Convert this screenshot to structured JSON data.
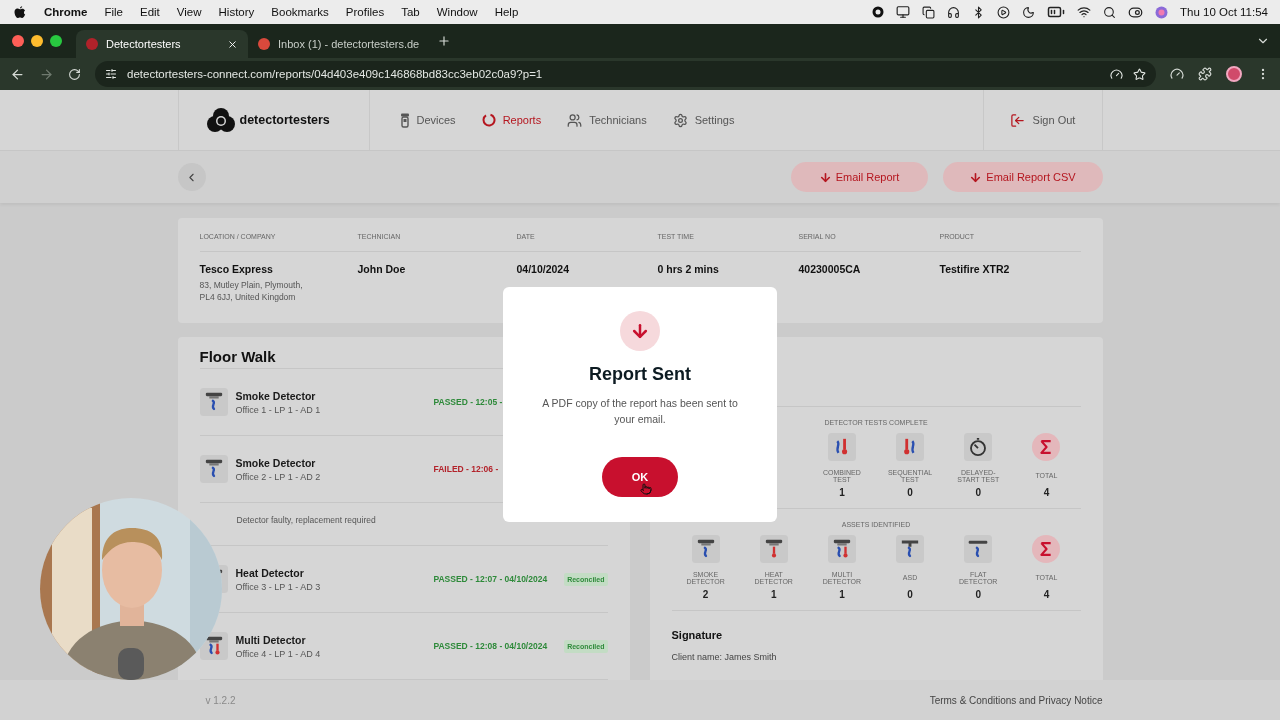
{
  "menu_bar": {
    "app": "Chrome",
    "menus": [
      "File",
      "Edit",
      "View",
      "History",
      "Bookmarks",
      "Profiles",
      "Tab",
      "Window",
      "Help"
    ],
    "clock": "Thu 10 Oct  11:54"
  },
  "browser": {
    "tabs": [
      {
        "title": "Detectortesters",
        "selected": true
      },
      {
        "title": "Inbox (1) - detectortesters.de",
        "selected": false
      }
    ],
    "url": "detectortesters-connect.com/reports/04d403e409c146868bd83cc3eb02c0a9?p=1"
  },
  "header": {
    "logo": "detectortesters",
    "nav": [
      {
        "label": "Devices",
        "kind": "devices",
        "selected": false
      },
      {
        "label": "Reports",
        "kind": "reports",
        "selected": true
      },
      {
        "label": "Technicians",
        "kind": "technicians",
        "selected": false
      },
      {
        "label": "Settings",
        "kind": "settings",
        "selected": false
      }
    ],
    "sign_out": "Sign Out"
  },
  "actions": [
    "Email Report",
    "Email Report CSV"
  ],
  "info": [
    {
      "label": "LOCATION / COMPANY",
      "value": "Tesco Express",
      "detail": [
        "83, Mutley Plain, Plymouth,",
        "PL4 6JJ, United Kingdom"
      ]
    },
    {
      "label": "TECHNICIAN",
      "value": "John Doe"
    },
    {
      "label": "DATE",
      "value": "04/10/2024"
    },
    {
      "label": "TEST TIME",
      "value": "0 hrs 2 mins"
    },
    {
      "label": "SERIAL NO",
      "value": "40230005CA"
    },
    {
      "label": "PRODUCT",
      "value": "Testifire XTR2"
    }
  ],
  "floor_walk": {
    "title": "Floor Walk",
    "rows": [
      {
        "kind": "smoke",
        "name": "Smoke Detector",
        "location": "Office 1 - LP 1 - AD 1",
        "result": "PASSED - 12:05 -",
        "passed": true
      },
      {
        "kind": "smoke",
        "name": "Smoke Detector",
        "location": "Office 2 - LP 1 - AD 2",
        "result": "FAILED - 12:06 -",
        "passed": false,
        "note": "Detector faulty, replacement required"
      },
      {
        "kind": "heat",
        "name": "Heat Detector",
        "location": "Office 3 - LP 1 - AD 3",
        "result": "PASSED - 12:07 - 04/10/2024",
        "passed": true,
        "badge": "Reconciled"
      },
      {
        "kind": "multi",
        "name": "Multi Detector",
        "location": "Office 4 - LP 1 - AD 4",
        "result": "PASSED - 12:08 - 04/10/2024",
        "passed": true,
        "badge": "Reconciled"
      }
    ]
  },
  "summary": {
    "tests": {
      "title": "DETECTOR TESTS COMPLETE",
      "items": [
        {
          "kind": "combined",
          "label": "COMBINED TEST",
          "count": "1"
        },
        {
          "kind": "sequential",
          "label": "SEQUENTIAL TEST",
          "count": "0"
        },
        {
          "kind": "delayed",
          "label": "DELAYED-START TEST",
          "count": "0"
        },
        {
          "kind": "total",
          "label": "TOTAL",
          "count": "4"
        }
      ]
    },
    "assets": {
      "title": "ASSETS IDENTIFIED",
      "items": [
        {
          "kind": "smoke",
          "label": "SMOKE DETECTOR",
          "count": "2"
        },
        {
          "kind": "heat",
          "label": "HEAT DETECTOR",
          "count": "1"
        },
        {
          "kind": "multi",
          "label": "MULTI DETECTOR",
          "count": "1"
        },
        {
          "kind": "asd",
          "label": "ASD",
          "count": "0"
        },
        {
          "kind": "flat",
          "label": "FLAT DETECTOR",
          "count": "0"
        },
        {
          "kind": "total",
          "label": "TOTAL",
          "count": "4"
        }
      ]
    },
    "signature": {
      "title": "Signature",
      "client": "Client name: James Smith"
    }
  },
  "modal": {
    "title": "Report Sent",
    "message": "A PDF copy of the report has been sent to your email.",
    "button": "OK"
  },
  "footer": {
    "version": "v 1.2.2",
    "link": "Terms & Conditions and Privacy Notice"
  }
}
